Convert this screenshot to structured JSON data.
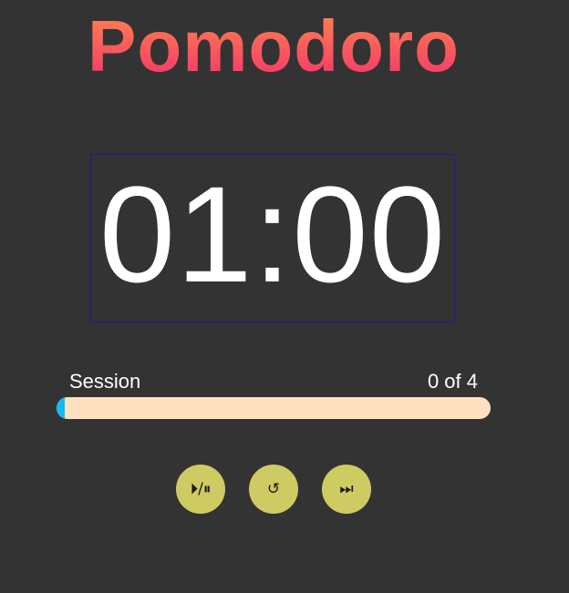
{
  "app": {
    "title": "Pomodoro",
    "title_gradient": [
      "#ff8a4c",
      "#f4306d"
    ],
    "background": "#333333"
  },
  "timer": {
    "display": "01:00"
  },
  "session": {
    "label": "Session",
    "count_text": "0 of 4",
    "completed": 0,
    "total": 4,
    "progress_fraction": 0.0,
    "track_color": "#ffe1c0",
    "fill_color": "#11bbee"
  },
  "controls": {
    "play_pause": {
      "glyph": "⏵/⏸",
      "icon": "play-pause-icon"
    },
    "reset": {
      "glyph": "↺",
      "icon": "reset-icon"
    },
    "skip": {
      "glyph": "⏭",
      "icon": "skip-next-icon"
    },
    "button_color": "#cfcb63"
  }
}
